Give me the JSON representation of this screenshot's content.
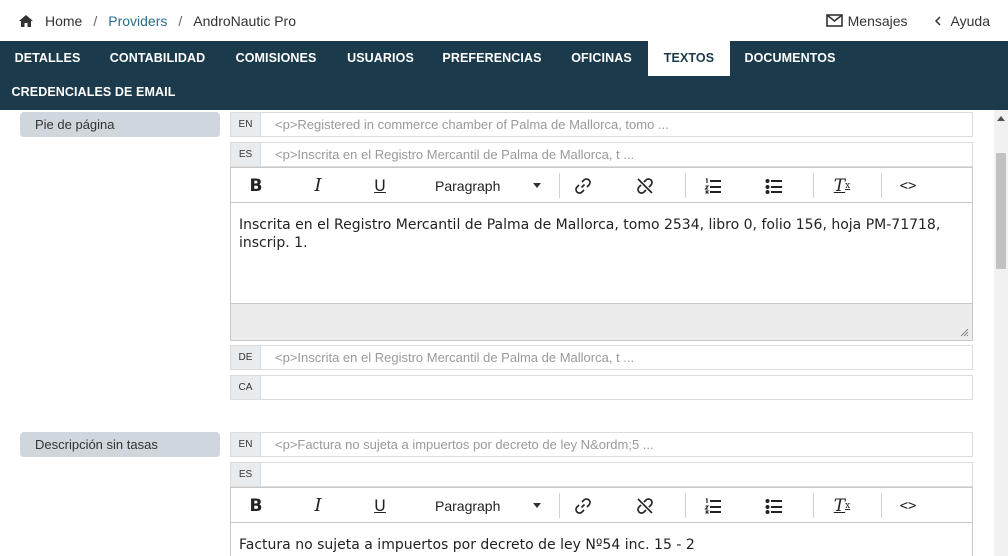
{
  "breadcrumb": {
    "home": "Home",
    "providers": "Providers",
    "current": "AndroNautic Pro",
    "separator": "/"
  },
  "top_right": {
    "messages": "Mensajes",
    "help": "Ayuda"
  },
  "tabs": [
    {
      "label": "DETALLES",
      "active": false
    },
    {
      "label": "CONTABILIDAD",
      "active": false
    },
    {
      "label": "COMISIONES",
      "active": false
    },
    {
      "label": "USUARIOS",
      "active": false
    },
    {
      "label": "PREFERENCIAS",
      "active": false
    },
    {
      "label": "OFICINAS",
      "active": false
    },
    {
      "label": "TEXTOS",
      "active": true
    },
    {
      "label": "DOCUMENTOS",
      "active": false
    },
    {
      "label": "CREDENCIALES DE EMAIL",
      "active": false
    }
  ],
  "toolbar": {
    "bold": "B",
    "italic": "I",
    "underline": "U",
    "paragraph": "Paragraph",
    "clear_main": "T",
    "clear_sub": "x",
    "code": "<>"
  },
  "sections": [
    {
      "label": "Pie de página",
      "langs": [
        {
          "code": "EN",
          "preview": "<p>Registered in commerce chamber of Palma de Mallorca, tomo ..."
        },
        {
          "code": "ES",
          "preview": "<p>Inscrita en el Registro Mercantil de Palma de Mallorca, t ..."
        },
        {
          "code": "DE",
          "preview": "<p>Inscrita en el Registro Mercantil de Palma de Mallorca, t ..."
        },
        {
          "code": "CA",
          "preview": ""
        }
      ],
      "editor_text": "Inscrita en el Registro Mercantil de Palma de Mallorca, tomo 2534, libro 0, folio 156, hoja PM-71718, inscrip. 1."
    },
    {
      "label": "Descripción sin tasas",
      "langs": [
        {
          "code": "EN",
          "preview": "<p>Factura no sujeta a impuertos por decreto de ley N&ordm;5 ..."
        },
        {
          "code": "ES",
          "preview": ""
        }
      ],
      "editor_text": "Factura no sujeta a impuertos por decreto de ley Nº54 inc. 15 - 2"
    }
  ],
  "colors": {
    "navbar": "#1b3b4c",
    "link": "#2b6e8a",
    "section_label_bg": "#cfd6dc"
  }
}
